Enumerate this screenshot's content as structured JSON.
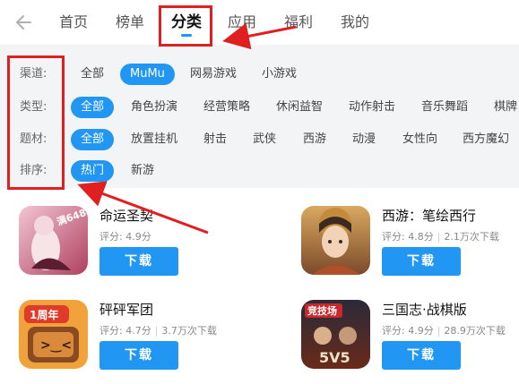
{
  "nav": {
    "tabs": [
      "首页",
      "榜单",
      "分类",
      "应用",
      "福利",
      "我的"
    ],
    "active_tab": "分类"
  },
  "filters": {
    "channel": {
      "label": "渠道:",
      "options": [
        "全部",
        "MuMu",
        "网易游戏",
        "小游戏"
      ],
      "selected": "MuMu"
    },
    "type": {
      "label": "类型:",
      "options": [
        "全部",
        "角色扮演",
        "经营策略",
        "休闲益智",
        "动作射击",
        "音乐舞蹈",
        "棋牌"
      ],
      "selected": "全部"
    },
    "theme": {
      "label": "题材:",
      "options": [
        "全部",
        "放置挂机",
        "射击",
        "武侠",
        "西游",
        "动漫",
        "女性向",
        "西方魔幻"
      ],
      "selected": "全部"
    },
    "sort": {
      "label": "排序:",
      "options": [
        "热门",
        "新游"
      ],
      "selected": "热门"
    }
  },
  "apps": [
    {
      "name": "命运圣契",
      "rating": "评分: 4.9分",
      "downloads": "",
      "button": "下载",
      "icon": "mingyun-shengqi-icon",
      "badge_text": "满648"
    },
    {
      "name": "西游：笔绘西行",
      "rating": "评分: 4.8分",
      "downloads": "2.1万次下载",
      "button": "下载",
      "icon": "xiyou-bihui-icon"
    },
    {
      "name": "砰砰军团",
      "rating": "评分: 4.7分",
      "downloads": "3.7万次下载",
      "button": "下载",
      "icon": "pengpeng-juntuan-icon",
      "badge_text": "1周年"
    },
    {
      "name": "三国志·战棋版",
      "rating": "评分: 4.9分",
      "downloads": "28.9万次下载",
      "button": "下载",
      "icon": "sanguozhi-zhanqi-icon",
      "badge_text": "竞技场",
      "badge_text2": "5V5"
    }
  ],
  "colors": {
    "accent": "#2196f3",
    "annotation": "#e02020",
    "filter_bg": "#f2f4f6"
  }
}
